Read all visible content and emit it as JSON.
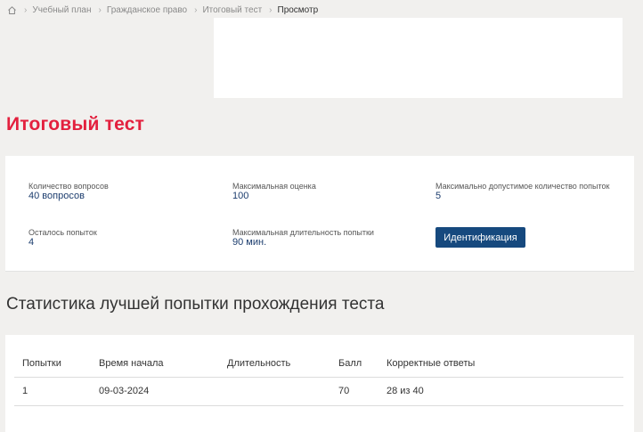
{
  "breadcrumb": {
    "home_icon": "home-icon",
    "items": [
      "Учебный план",
      "Гражданское право",
      "Итоговый тест"
    ],
    "current": "Просмотр"
  },
  "page": {
    "title": "Итоговый тест"
  },
  "info": {
    "questions_label": "Количество вопросов",
    "questions_value": "40 вопросов",
    "max_score_label": "Максимальная оценка",
    "max_score_value": "100",
    "max_attempts_label": "Максимально допустимое количество попыток",
    "max_attempts_value": "5",
    "remaining_label": "Осталось попыток",
    "remaining_value": "4",
    "max_duration_label": "Максимальная длительность попытки",
    "max_duration_value": "90 мин.",
    "identify_button": "Идентификация"
  },
  "stats": {
    "title": "Статистика лучшей попытки прохождения теста",
    "columns": [
      "Попытки",
      "Время начала",
      "Длительность",
      "Балл",
      "Корректные ответы"
    ],
    "rows": [
      [
        "1",
        "09-03-2024",
        "",
        "70",
        "28 из 40"
      ]
    ]
  },
  "colors": {
    "title_red": "#e3203e",
    "value_blue": "#1c3d6e",
    "button_blue": "#16497e"
  }
}
